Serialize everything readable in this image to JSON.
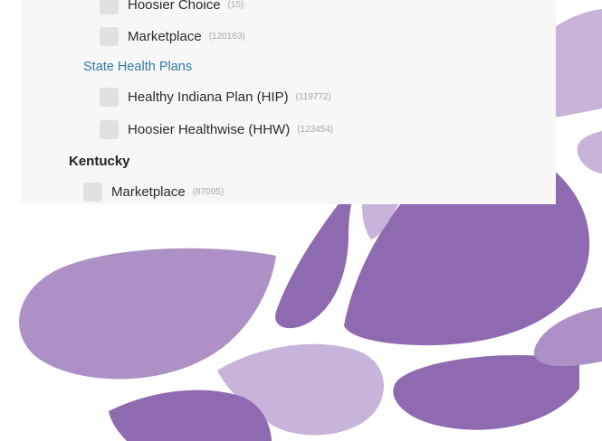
{
  "colors": {
    "panel_bg": "#f7f7f7",
    "checkbox": "#e1e1e1",
    "link": "#2f7aa8",
    "count": "#a8a8a8",
    "decor_dark": "#8e6ab0",
    "decor_mid": "#ac90c6",
    "decor_light": "#c8b3da"
  },
  "filters": {
    "hoosier_choice": {
      "label": "Hoosier Choice",
      "count": "(15)"
    },
    "marketplace_in": {
      "label": "Marketplace",
      "count": "(120163)"
    },
    "state_health_plans": {
      "label": "State Health Plans"
    },
    "hip": {
      "label": "Healthy Indiana Plan (HIP)",
      "count": "(119772)"
    },
    "hhw": {
      "label": "Hoosier Healthwise (HHW)",
      "count": "(123454)"
    },
    "kentucky": {
      "label": "Kentucky"
    },
    "marketplace_ky": {
      "label": "Marketplace",
      "count": "(87095)"
    }
  }
}
